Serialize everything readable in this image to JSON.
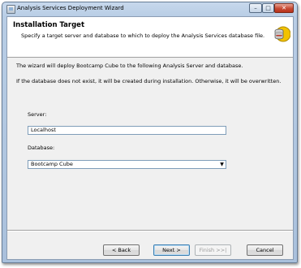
{
  "window": {
    "title": "Analysis Services Deployment Wizard",
    "minimize_glyph": "–",
    "maximize_glyph": "□",
    "close_glyph": "✕"
  },
  "header": {
    "title": "Installation Target",
    "subtitle": "Specify a target server and database to which to deploy the Analysis Services database file.",
    "icon": "database-deploy-icon"
  },
  "body": {
    "description_1": "The wizard will deploy Bootcamp Cube to the following Analysis Server and database.",
    "description_2": "If the database does not exist, it will be created during installation. Otherwise, it will be overwritten.",
    "server_label": "Server:",
    "server_value": "Localhost",
    "database_label": "Database:",
    "database_value": "Bootcamp Cube",
    "dropdown_glyph": "▼"
  },
  "buttons": {
    "back": "< Back",
    "next": "Next >",
    "finish": "Finish >>|",
    "cancel": "Cancel"
  }
}
